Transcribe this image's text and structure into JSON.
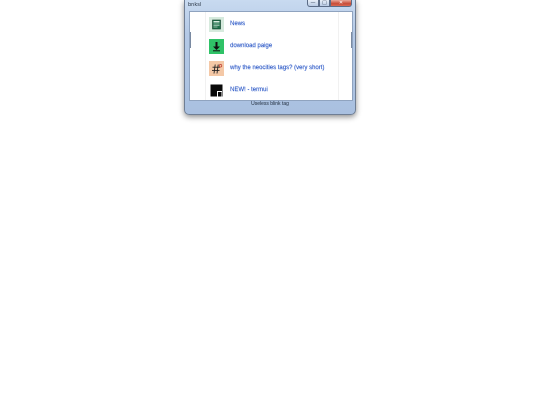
{
  "window": {
    "title": "bnksl",
    "minimize": "—",
    "maximize": "□",
    "close": "✕"
  },
  "links": [
    {
      "label": "News",
      "icon": "newspaper-icon"
    },
    {
      "label": "download paige",
      "icon": "download-arrow-icon"
    },
    {
      "label": "why the neocities tags? (very short)",
      "icon": "hashtag-icon"
    },
    {
      "label": "NEW! - termui",
      "icon": "terminal-window-icon"
    }
  ],
  "status": {
    "text": "Useless blink tag"
  }
}
